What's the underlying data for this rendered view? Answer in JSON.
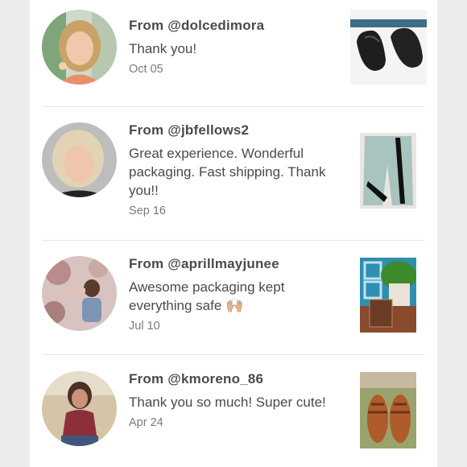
{
  "reviews": [
    {
      "from": "From @dolcedimora",
      "message": "Thank you!",
      "date": "Oct 05",
      "avatar_icon": "user-photo-icon",
      "product_icon": "loafers-photo-icon"
    },
    {
      "from": "From @jbfellows2",
      "message": "Great experience. Wonderful packaging. Fast shipping. Thank you!!",
      "date": "Sep 16",
      "avatar_icon": "user-photo-icon",
      "product_icon": "pants-photo-icon"
    },
    {
      "from": "From @aprillmayjunee",
      "message": "Awesome packaging kept everything safe",
      "emoji": "🙌🏼",
      "date": "Jul 10",
      "avatar_icon": "user-photo-icon",
      "product_icon": "plant-box-photo-icon"
    },
    {
      "from": "From @kmoreno_86",
      "message": "Thank you so much! Super cute!",
      "date": "Apr 24",
      "avatar_icon": "user-photo-icon",
      "product_icon": "sandals-photo-icon"
    }
  ],
  "colors": {
    "background": "#ececec",
    "panel": "#ffffff",
    "text": "#4a4a4a",
    "muted": "#7a7a7a",
    "divider": "#e6e6e6"
  }
}
